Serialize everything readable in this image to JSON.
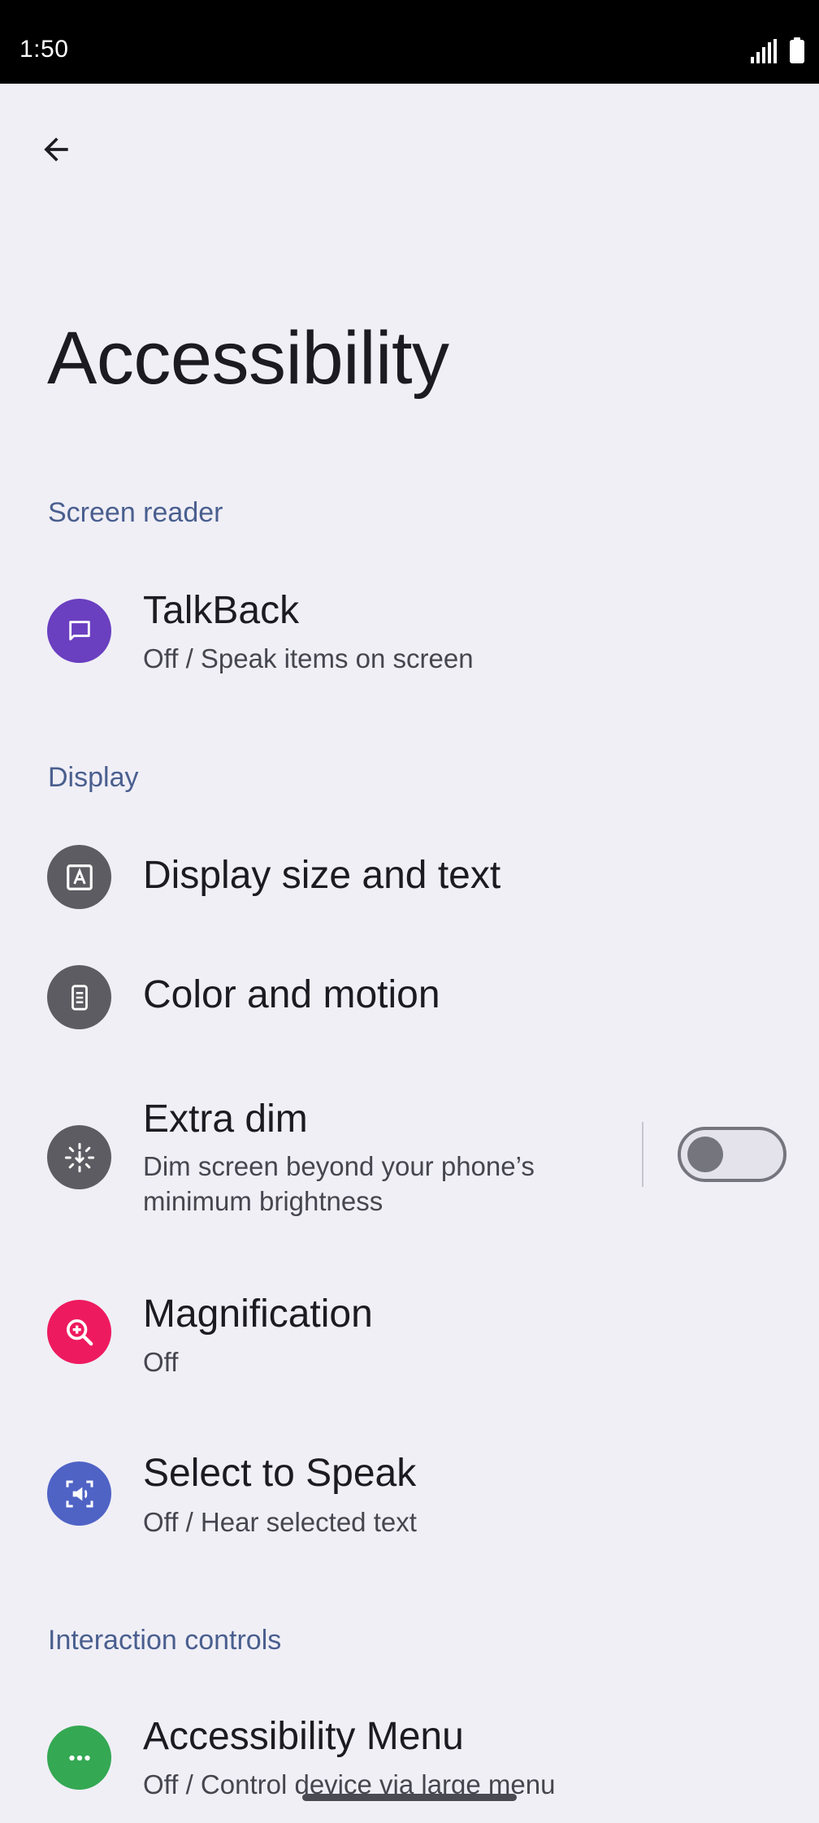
{
  "status_bar": {
    "time": "1:50",
    "signal_icon": "signal-icon",
    "battery_icon": "battery-icon"
  },
  "header": {
    "back_icon": "arrow-back-icon",
    "title": "Accessibility"
  },
  "sections": {
    "screen_reader": "Screen reader",
    "display": "Display",
    "interaction": "Interaction controls"
  },
  "items": {
    "talkback": {
      "title": "TalkBack",
      "subtitle": "Off / Speak items on screen",
      "icon": "chat-bubble-icon",
      "icon_color": "#6a3fc0"
    },
    "display_size": {
      "title": "Display size and text",
      "icon": "text-format-icon",
      "icon_color": "#5c5c62"
    },
    "color_motion": {
      "title": "Color and motion",
      "icon": "phone-display-icon",
      "icon_color": "#5c5c62"
    },
    "extra_dim": {
      "title": "Extra dim",
      "subtitle_line1": "Dim screen beyond your phone’s",
      "subtitle_line2": "minimum brightness",
      "icon": "brightness-down-icon",
      "icon_color": "#5c5c62",
      "toggle_on": false
    },
    "magnification": {
      "title": "Magnification",
      "subtitle": "Off",
      "icon": "zoom-in-icon",
      "icon_color": "#ee1a5f"
    },
    "select_to_speak": {
      "title": "Select to Speak",
      "subtitle": "Off / Hear selected text",
      "icon": "speaker-select-icon",
      "icon_color": "#4f63c5"
    },
    "accessibility_menu": {
      "title": "Accessibility Menu",
      "subtitle": "Off / Control device via large menu",
      "icon": "more-dots-icon",
      "icon_color": "#34a853"
    }
  }
}
